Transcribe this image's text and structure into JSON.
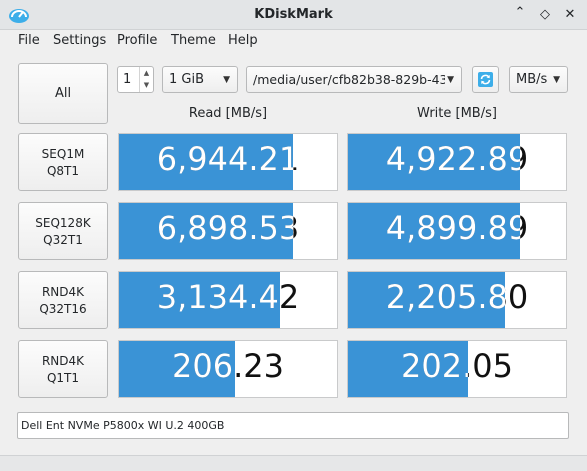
{
  "window": {
    "title": "KDiskMark",
    "minimize": "⌃",
    "maximize": "◇",
    "close": "✕"
  },
  "menu": [
    "File",
    "Settings",
    "Profile",
    "Theme",
    "Help"
  ],
  "controls": {
    "all_label": "All",
    "runs": "1",
    "size": "1 GiB",
    "path": "/media/user/cfb82b38-829b-43",
    "unit": "MB/s"
  },
  "headers": {
    "read": "Read [MB/s]",
    "write": "Write [MB/s]"
  },
  "tests": [
    {
      "line1": "SEQ1M",
      "line2": "Q8T1",
      "read": "6,944.21",
      "read_fill": 0.8,
      "write": "4,922.89",
      "write_fill": 0.79
    },
    {
      "line1": "SEQ128K",
      "line2": "Q32T1",
      "read": "6,898.53",
      "read_fill": 0.8,
      "write": "4,899.89",
      "write_fill": 0.79
    },
    {
      "line1": "RND4K",
      "line2": "Q32T16",
      "read": "3,134.42",
      "read_fill": 0.74,
      "write": "2,205.80",
      "write_fill": 0.72
    },
    {
      "line1": "RND4K",
      "line2": "Q1T1",
      "read": "206.23",
      "read_fill": 0.53,
      "write": "202.05",
      "write_fill": 0.55
    }
  ],
  "device": "Dell Ent NVMe P5800x WI U.2 400GB"
}
